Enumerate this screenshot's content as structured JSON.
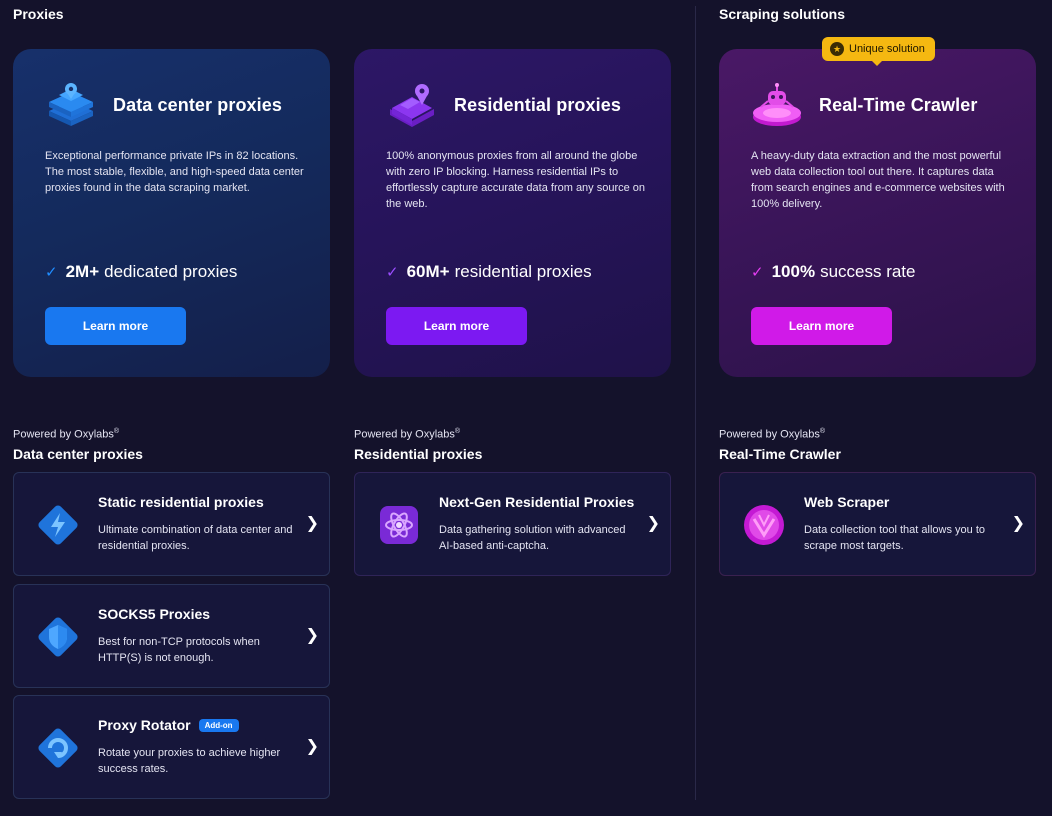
{
  "sections": {
    "proxies": "Proxies",
    "scraping": "Scraping solutions"
  },
  "cards": [
    {
      "title": "Data center proxies",
      "desc": "Exceptional performance private IPs in 82 locations. The most stable, flexible, and high-speed data center proxies found in the data scraping market.",
      "stat_bold": "2M+",
      "stat_text": "dedicated proxies",
      "button": "Learn more",
      "icon": "server-stack-icon",
      "accent": "#1978f0"
    },
    {
      "title": "Residential proxies",
      "desc": "100% anonymous proxies from all around the globe with zero IP blocking. Harness residential IPs to effortlessly capture accurate data from any source on the web.",
      "stat_bold": "60M+",
      "stat_text": "residential proxies",
      "button": "Learn more",
      "icon": "house-pin-icon",
      "accent": "#7c19f2"
    },
    {
      "title": "Real-Time Crawler",
      "desc": "A heavy-duty data extraction and the most powerful web data collection tool out there. It captures data from search engines and e-commerce websites with 100% delivery.",
      "stat_bold": "100%",
      "stat_text": "success rate",
      "button": "Learn more",
      "icon": "robot-platform-icon",
      "accent": "#d01ae8"
    }
  ],
  "unique_badge": "Unique solution",
  "check_mark": "✓",
  "chevron": "❯",
  "powered": {
    "text": "Powered by Oxylabs",
    "reg": "®"
  },
  "lists": [
    {
      "title": "Data center proxies",
      "items": [
        {
          "title": "Static residential proxies",
          "desc": "Ultimate combination of data center and residential proxies.",
          "icon": "lightning-diamond-icon"
        },
        {
          "title": "SOCKS5 Proxies",
          "desc": "Best for non-TCP protocols when HTTP(S) is not enough.",
          "icon": "shield-diamond-icon"
        },
        {
          "title": "Proxy Rotator",
          "badge": "Add-on",
          "desc": "Rotate your proxies to achieve higher success rates.",
          "icon": "rotate-diamond-icon"
        }
      ]
    },
    {
      "title": "Residential proxies",
      "items": [
        {
          "title": "Next-Gen Residential Proxies",
          "desc": "Data gathering solution with advanced AI-based anti-captcha.",
          "icon": "atom-icon"
        }
      ]
    },
    {
      "title": "Real-Time Crawler",
      "items": [
        {
          "title": "Web Scraper",
          "desc": "Data collection tool that allows you to scrape most targets.",
          "icon": "spider-web-icon"
        }
      ]
    }
  ]
}
